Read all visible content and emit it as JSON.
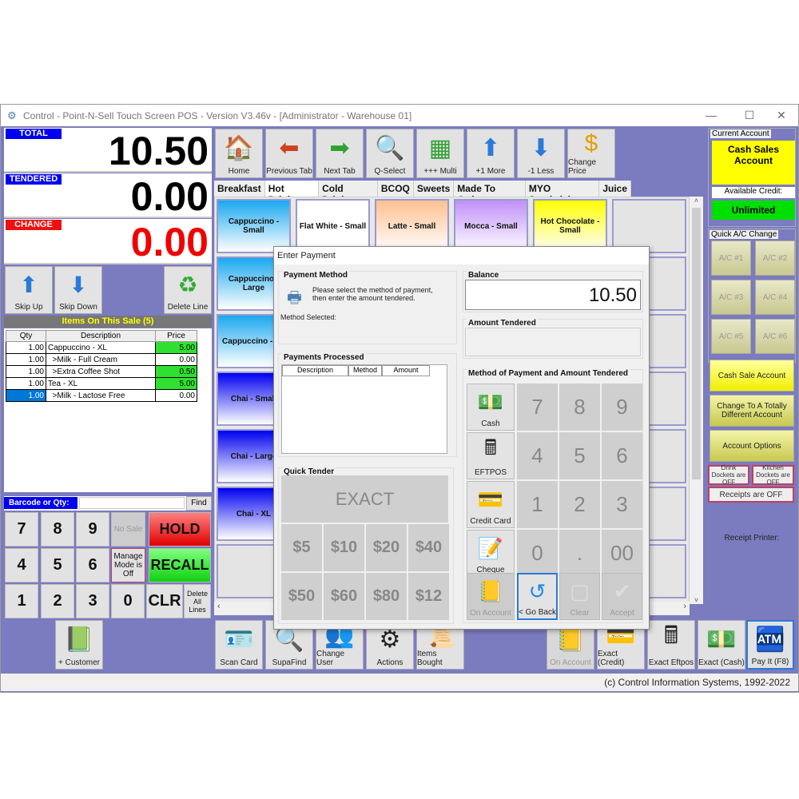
{
  "window": {
    "title": "Control - Point-N-Sell Touch Screen POS - Version V3.46v - [Administrator - Warehouse 01]",
    "minimize": "—",
    "maximize": "☐",
    "close": "✕"
  },
  "display": {
    "total_label": "TOTAL",
    "total_value": "10.50",
    "tendered_label": "TENDERED",
    "tendered_value": "0.00",
    "change_label": "CHANGE",
    "change_value": "0.00"
  },
  "line_buttons": {
    "skip_up": "Skip Up",
    "skip_down": "Skip Down",
    "delete_line": "Delete Line"
  },
  "sale": {
    "header": "Items On This Sale (5)",
    "columns": [
      "Qty",
      "Description",
      "Price"
    ],
    "rows": [
      {
        "qty": "1.00",
        "desc": "Cappuccino - XL",
        "price": "5.00",
        "highlight": true
      },
      {
        "qty": "1.00",
        "desc": "  >Milk - Full Cream",
        "price": "0.00",
        "highlight": false
      },
      {
        "qty": "1.00",
        "desc": "  >Extra Coffee Shot",
        "price": "0.50",
        "highlight": true
      },
      {
        "qty": "1.00",
        "desc": "Tea - XL",
        "price": "5.00",
        "highlight": true
      },
      {
        "qty": "1.00",
        "desc": "  >Milk - Lactose Free",
        "price": "0.00",
        "highlight": false,
        "selected": true
      }
    ]
  },
  "barcode": {
    "label": "Barcode or Qty:",
    "value": "",
    "find": "Find"
  },
  "keypad": {
    "keys": [
      "7",
      "8",
      "9",
      "4",
      "5",
      "6",
      "1",
      "2",
      "3",
      "0"
    ],
    "no_sale": "No Sale",
    "manage_mode": "Manage Mode is Off",
    "hold": "HOLD",
    "recall": "RECALL",
    "clr": "CLR",
    "delete_all": "Delete All Lines"
  },
  "toolbar": [
    {
      "label": "Home",
      "icon": "🏠"
    },
    {
      "label": "Previous Tab",
      "icon": "⬅"
    },
    {
      "label": "Next Tab",
      "icon": "➡"
    },
    {
      "label": "Q-Select",
      "icon": "🔍"
    },
    {
      "label": "+++ Multi",
      "icon": "▦"
    },
    {
      "label": "+1 More",
      "icon": "⬆"
    },
    {
      "label": "-1 Less",
      "icon": "⬇"
    },
    {
      "label": "Change Price",
      "icon": "$"
    }
  ],
  "tabs": [
    "Breakfast",
    "Hot Drinks",
    "Cold Drinks",
    "BCOQ",
    "Sweets",
    "Made To Order",
    "MYO Sandwich",
    "Juice"
  ],
  "active_tab": "Hot Drinks",
  "products": [
    {
      "label": "Cappuccino - Small",
      "color": "#1aa8f0"
    },
    {
      "label": "Flat White - Small",
      "color": "#ffffff"
    },
    {
      "label": "Latte - Small",
      "color": "#ffc090"
    },
    {
      "label": "Mocca - Small",
      "color": "#c090f8"
    },
    {
      "label": "Hot Chocolate - Small",
      "color": "#ffff00"
    },
    {
      "label": "Cappuccino - Large",
      "color": "#1aa8f0"
    },
    {
      "label": "Cappuccino - XL",
      "color": "#1aa8f0"
    },
    {
      "label": "Chai - Small",
      "color": "#0000f0"
    },
    {
      "label": "Chai - Large",
      "color": "#0000f0"
    },
    {
      "label": "Chai - XL",
      "color": "#0000f0"
    }
  ],
  "account": {
    "group_label": "Current Account",
    "name": "Cash Sales Account",
    "credit_label": "Available Credit:",
    "credit_value": "Unlimited",
    "quick_label": "Quick A/C Change",
    "quick": [
      "A/C #1",
      "A/C #2",
      "A/C #3",
      "A/C #4",
      "A/C #5",
      "A/C #6"
    ],
    "cash_sale": "Cash Sale Account",
    "change_account": "Change To A Totally Different Account",
    "options": "Account Options",
    "drink_dockets": "Drink Dockets are OFF",
    "kitchen_dockets": "Kitchen Dockets are OFF",
    "receipts": "Receipts are OFF",
    "printer": "Receipt Printer:"
  },
  "bottom": [
    {
      "label": "+ Customer",
      "icon": "📗"
    },
    {
      "label": "Scan Card",
      "icon": "🪪"
    },
    {
      "label": "SupaFind",
      "icon": "🔍"
    },
    {
      "label": "Change User",
      "icon": "👥"
    },
    {
      "label": "Actions",
      "icon": "⚙"
    },
    {
      "label": "Items Bought",
      "icon": "📜"
    },
    {
      "label": "On Account",
      "icon": "📒"
    },
    {
      "label": "Exact (Credit)",
      "icon": "💳"
    },
    {
      "label": "Exact Eftpos",
      "icon": "🖩"
    },
    {
      "label": "Exact (Cash)",
      "icon": "💵"
    },
    {
      "label": "Pay It (F8)",
      "icon": "🏧"
    }
  ],
  "status": "(c) Control Information Systems, 1992-2022",
  "dialog": {
    "title": "Enter Payment",
    "method_group": "Payment Method",
    "instructions": "Please select the method of payment, then enter the amount tendered.",
    "method_selected": "Method Selected:",
    "processed_group": "Payments Processed",
    "processed_cols": [
      "Description",
      "Method",
      "Amount"
    ],
    "quick_group": "Quick Tender",
    "exact": "EXACT",
    "quick_amounts": [
      "$5",
      "$10",
      "$20",
      "$40",
      "$50",
      "$60",
      "$80",
      "$12"
    ],
    "balance_label": "Balance",
    "balance_value": "10.50",
    "tendered_label": "Amount Tendered",
    "tendered_value": "",
    "pad_group": "Method of Payment and Amount Tendered",
    "methods": [
      {
        "label": "Cash",
        "icon": "💵"
      },
      {
        "label": "EFTPOS",
        "icon": "🖩"
      },
      {
        "label": "Credit Card",
        "icon": "💳"
      },
      {
        "label": "Cheque",
        "icon": "📝"
      }
    ],
    "pad_keys": [
      "7",
      "8",
      "9",
      "4",
      "5",
      "6",
      "1",
      "2",
      "3",
      "0",
      ".",
      "00"
    ],
    "on_account": "On Account",
    "go_back": "< Go Back",
    "clear": "Clear",
    "accept": "Accept"
  }
}
